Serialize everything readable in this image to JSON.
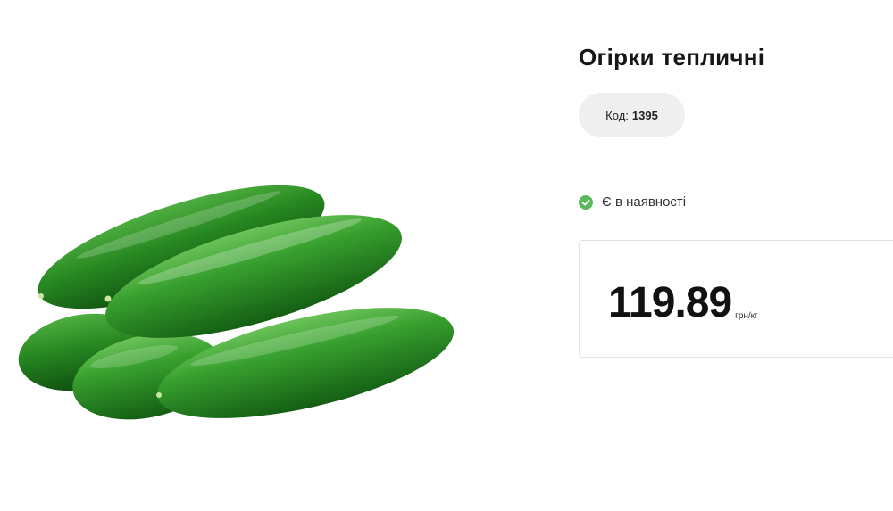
{
  "product": {
    "title": "Огірки тепличні",
    "code_label": "Код:",
    "code_value": "1395",
    "availability": "Є в наявності",
    "price_value": "119.89",
    "price_unit": "грн/кг",
    "image_subject": "cucumbers"
  },
  "icons": {
    "availability_icon": "check-circle-icon"
  },
  "colors": {
    "availability_green": "#5bb85c",
    "code_pill_bg": "#efefef",
    "price_border": "#e3e3e3",
    "cucumber_green": "#2f8f2a"
  }
}
